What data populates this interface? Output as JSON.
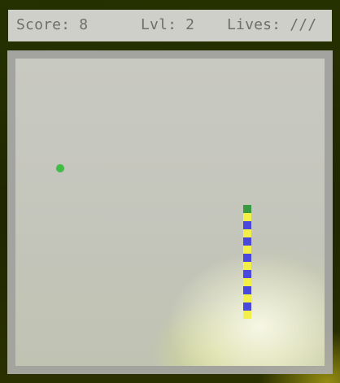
{
  "hud": {
    "score_text": "Score: 8",
    "level_text": "Lvl: 2",
    "lives_text": "Lives: ///"
  },
  "game": {
    "grid_columns": 38,
    "grid_rows": 37,
    "food": {
      "col": 5,
      "row": 13,
      "color": "#3fbd47"
    },
    "snake": {
      "head_color": "#3a9a42",
      "colors": [
        "#4a47dd",
        "#f2ef48"
      ],
      "segments": [
        {
          "col": 28,
          "row": 18,
          "kind": "head"
        },
        {
          "col": 28,
          "row": 19,
          "kind": "yellow"
        },
        {
          "col": 28,
          "row": 20,
          "kind": "blue"
        },
        {
          "col": 28,
          "row": 21,
          "kind": "yellow"
        },
        {
          "col": 28,
          "row": 22,
          "kind": "blue"
        },
        {
          "col": 28,
          "row": 23,
          "kind": "yellow"
        },
        {
          "col": 28,
          "row": 24,
          "kind": "blue"
        },
        {
          "col": 28,
          "row": 25,
          "kind": "yellow"
        },
        {
          "col": 28,
          "row": 26,
          "kind": "blue"
        },
        {
          "col": 28,
          "row": 27,
          "kind": "yellow"
        },
        {
          "col": 28,
          "row": 28,
          "kind": "blue"
        },
        {
          "col": 28,
          "row": 29,
          "kind": "yellow"
        },
        {
          "col": 28,
          "row": 30,
          "kind": "blue"
        },
        {
          "col": 28,
          "row": 31,
          "kind": "yellow"
        }
      ]
    }
  }
}
